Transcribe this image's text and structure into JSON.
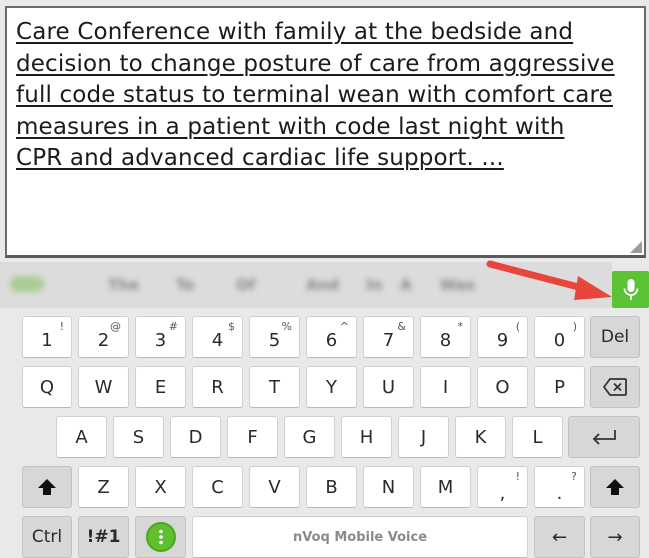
{
  "editor": {
    "text": "Care Conference with family at the bedside and decision to change posture of care from aggressive full code status to terminal wean with comfort care measures in a patient with code last night with CPR and advanced cardiac life support. ..."
  },
  "suggestions": [
    "The",
    "To",
    "Of",
    "And",
    "In",
    "A",
    "Was"
  ],
  "mic": {
    "icon": "microphone-icon",
    "color": "#5bc236"
  },
  "keyboard": {
    "number_row": [
      {
        "label": "1",
        "sup": "!"
      },
      {
        "label": "2",
        "sup": "@"
      },
      {
        "label": "3",
        "sup": "#"
      },
      {
        "label": "4",
        "sup": "$"
      },
      {
        "label": "5",
        "sup": "%"
      },
      {
        "label": "6",
        "sup": "^"
      },
      {
        "label": "7",
        "sup": "&"
      },
      {
        "label": "8",
        "sup": "*"
      },
      {
        "label": "9",
        "sup": "("
      },
      {
        "label": "0",
        "sup": ")"
      }
    ],
    "del_label": "Del",
    "row_q": [
      "Q",
      "W",
      "E",
      "R",
      "T",
      "Y",
      "U",
      "I",
      "O",
      "P"
    ],
    "row_a": [
      "A",
      "S",
      "D",
      "F",
      "G",
      "H",
      "J",
      "K",
      "L"
    ],
    "row_z": [
      "Z",
      "X",
      "C",
      "V",
      "B",
      "N",
      "M"
    ],
    "comma": {
      "label": ",",
      "sup": "!"
    },
    "period": {
      "label": ".",
      "sup": "?"
    },
    "ctrl_label": "Ctrl",
    "symbols_label": "!#1",
    "space_label": "nVoq Mobile Voice",
    "left_arrow": "←",
    "right_arrow": "→",
    "backspace_icon": "backspace-icon",
    "enter_icon": "enter-icon",
    "shift_icon": "shift-icon",
    "menu_icon": "more-vertical-icon"
  }
}
